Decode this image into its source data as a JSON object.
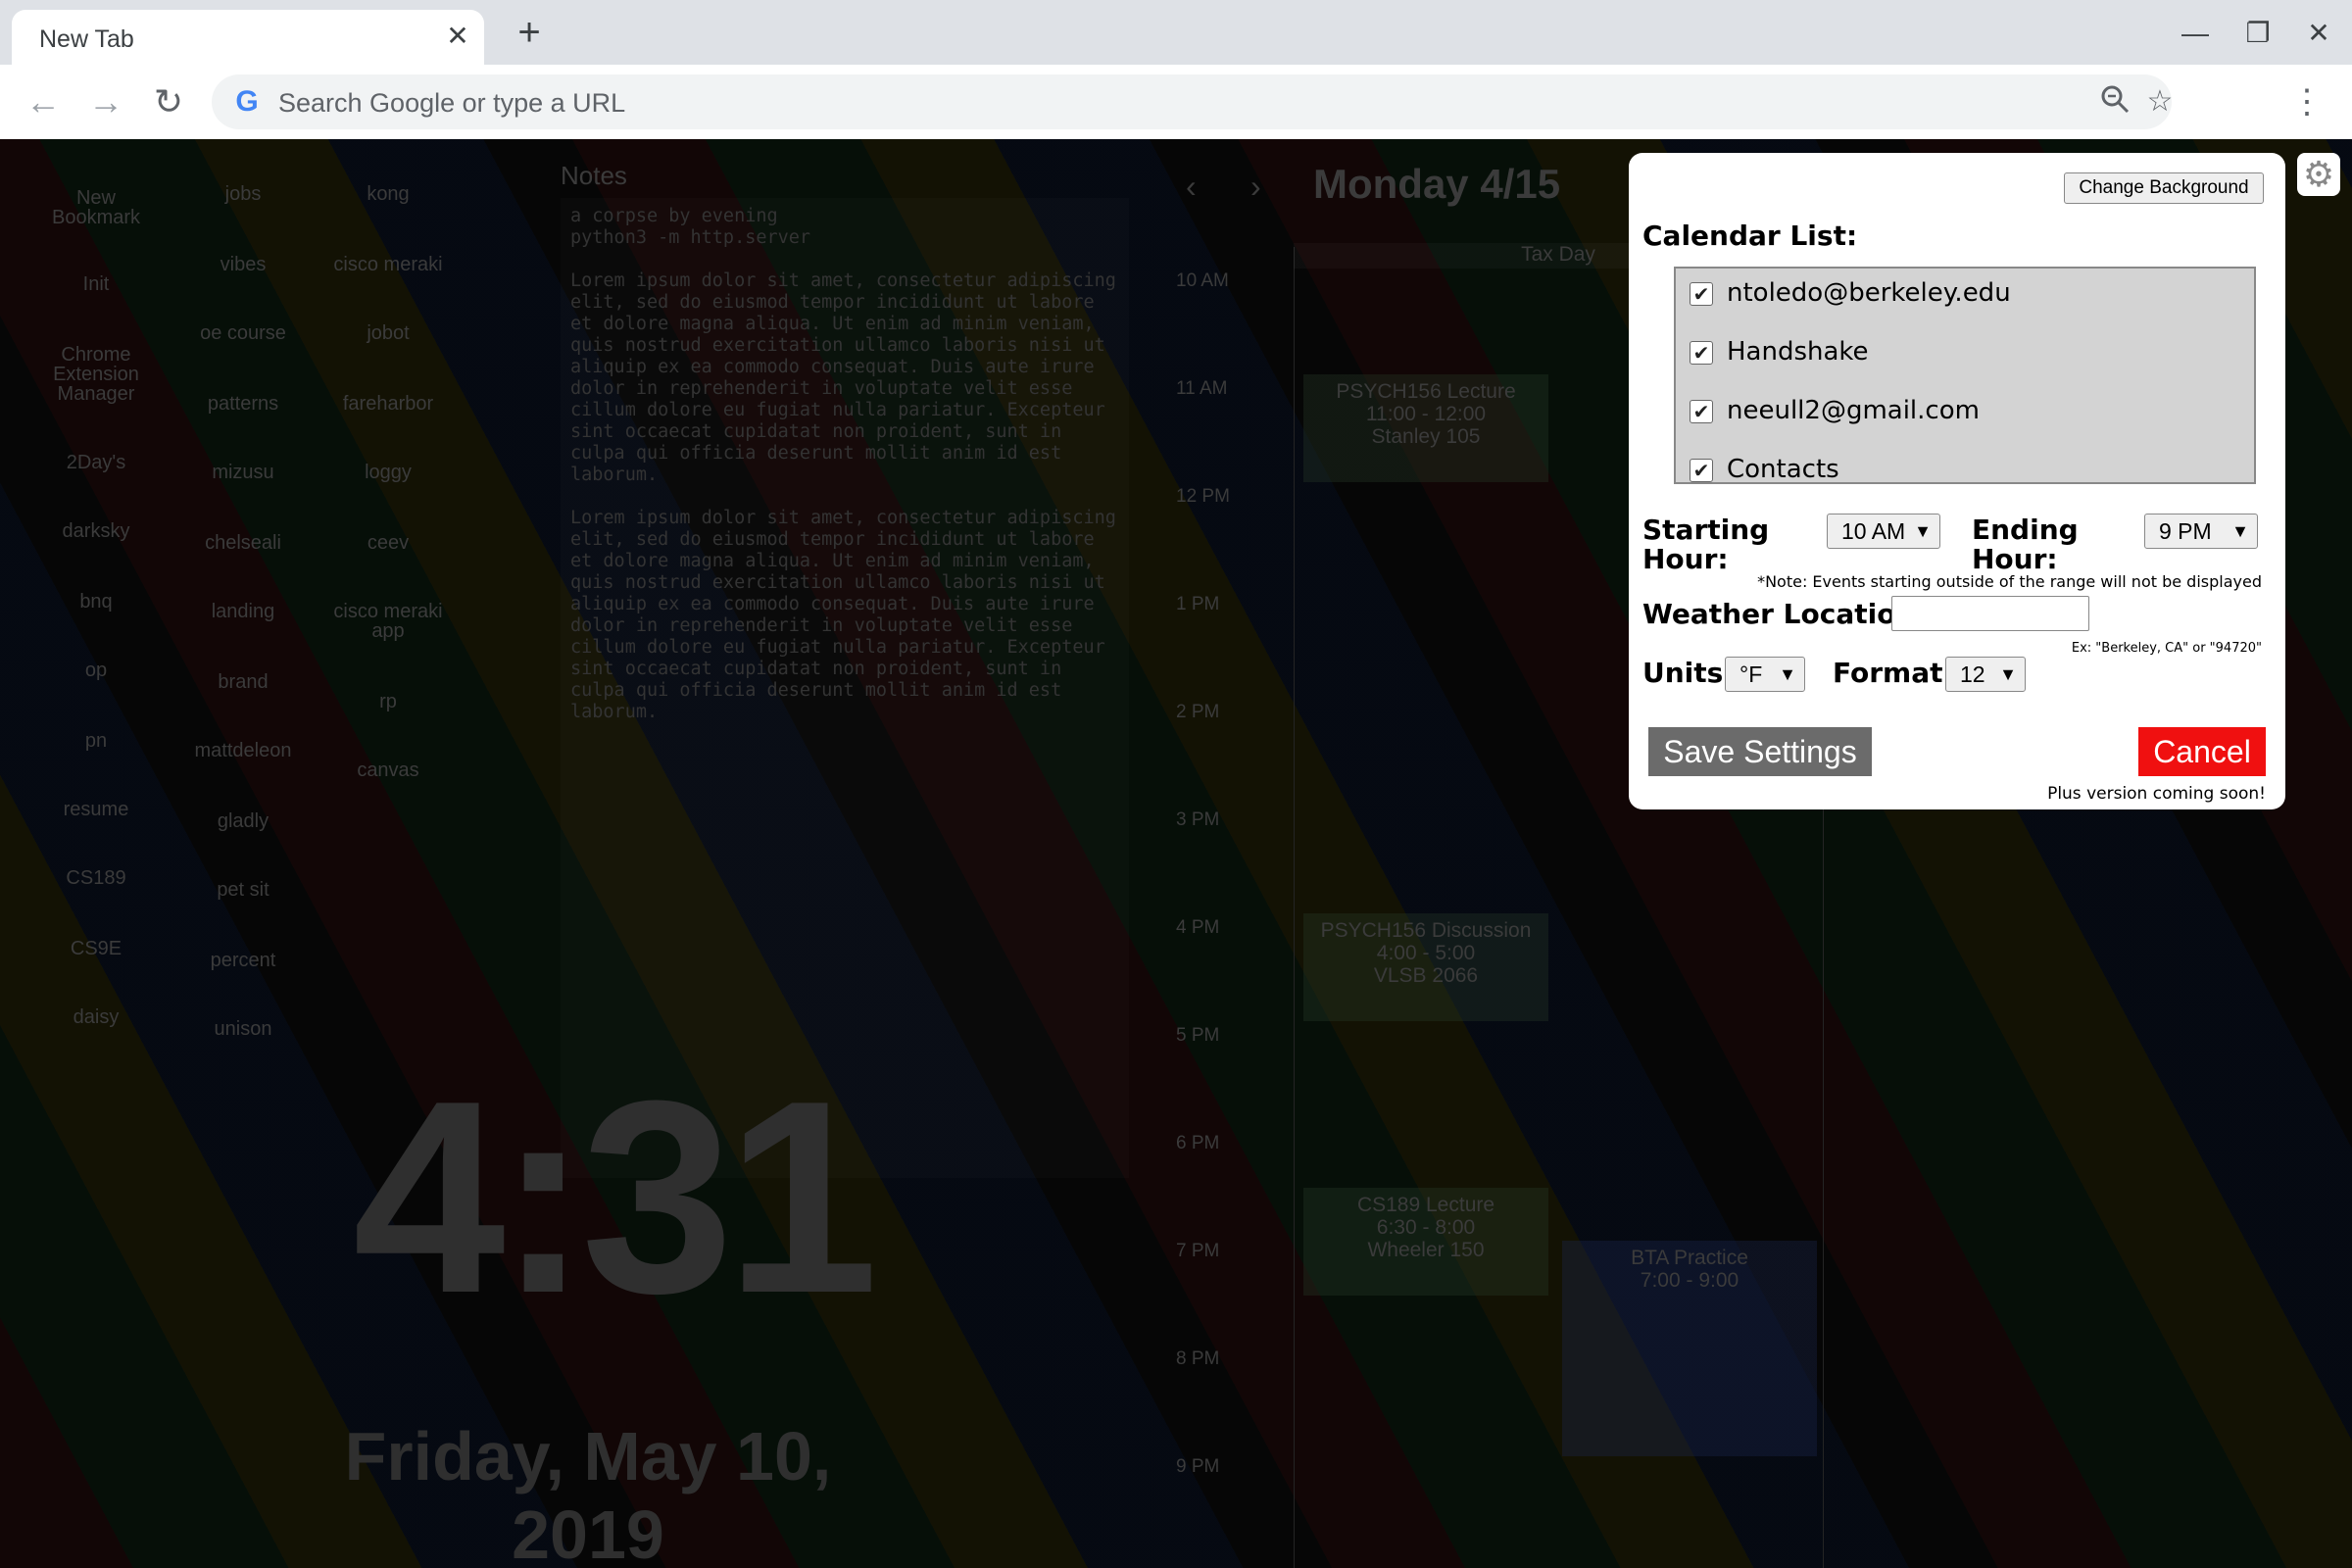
{
  "browser": {
    "tab_title": "New Tab",
    "tab_close": "✕",
    "new_tab": "+",
    "window_minimize": "—",
    "window_restore": "❐",
    "window_close": "✕",
    "omnibox_placeholder": "Search Google or type a URL",
    "google_logo": "G",
    "icons": [
      "back-arrow",
      "forward-arrow",
      "reload",
      "zoom",
      "star",
      "menu"
    ]
  },
  "bookmarks": {
    "column1": [
      "New Bookmark",
      "Init",
      "Chrome Extension Manager",
      "2Day's",
      "darksky",
      "bnq",
      "op",
      "pn",
      "resume",
      "CS189",
      "CS9E",
      "daisy"
    ],
    "column2": [
      "jobs",
      "vibes",
      "oe course",
      "patterns",
      "mizusu",
      "chelseali",
      "landing",
      "brand",
      "mattdeleon",
      "gladly",
      "pet sit",
      "percent",
      "unison"
    ],
    "column3": [
      "kong",
      "cisco meraki",
      "jobot",
      "fareharbor",
      "loggy",
      "ceev",
      "cisco meraki app",
      "rp",
      "canvas"
    ]
  },
  "notes": {
    "title": "Notes",
    "body": "a corpse by evening\npython3 -m http.server\n\nLorem ipsum dolor sit amet, consectetur adipiscing elit, sed do eiusmod tempor incididunt ut labore et dolore magna aliqua. Ut enim ad minim veniam, quis nostrud exercitation ullamco laboris nisi ut aliquip ex ea commodo consequat. Duis aute irure dolor in reprehenderit in voluptate velit esse cillum dolore eu fugiat nulla pariatur. Excepteur sint occaecat cupidatat non proident, sunt in culpa qui officia deserunt mollit anim id est laborum.\n\nLorem ipsum dolor sit amet, consectetur adipiscing elit, sed do eiusmod tempor incididunt ut labore et dolore magna aliqua. Ut enim ad minim veniam, quis nostrud exercitation ullamco laboris nisi ut aliquip ex ea commodo consequat. Duis aute irure dolor in reprehenderit in voluptate velit esse cillum dolore eu fugiat nulla pariatur. Excepteur sint occaecat cupidatat non proident, sunt in culpa qui officia deserunt mollit anim id est laborum."
  },
  "clock": {
    "time": "4:31",
    "date": "Friday, May 10, 2019"
  },
  "calendar": {
    "prev": "‹",
    "next": "›",
    "header": "Monday 4/15",
    "all_day_event": "Tax Day",
    "hours": [
      "10 AM",
      "11 AM",
      "12 PM",
      "1 PM",
      "2 PM",
      "3 PM",
      "4 PM",
      "5 PM",
      "6 PM",
      "7 PM",
      "8 PM",
      "9 PM"
    ],
    "events": [
      {
        "title": "PSYCH156 Lecture",
        "time": "11:00 - 12:00",
        "location": "Stanley 105"
      },
      {
        "title": "PSYCH156 Discussion",
        "time": "4:00 - 5:00",
        "location": "VLSB 2066"
      },
      {
        "title": "CS189 Lecture",
        "time": "6:30 - 8:00",
        "location": "Wheeler 150"
      },
      {
        "title": "BTA Practice",
        "time": "7:00 - 9:00",
        "location": ""
      }
    ]
  },
  "settings": {
    "gear_icon": "⚙",
    "change_background": "Change Background",
    "calendar_list_label": "Calendar List:",
    "calendars": [
      {
        "name": "ntoledo@berkeley.edu",
        "checked": true
      },
      {
        "name": "Handshake",
        "checked": true
      },
      {
        "name": "neeull2@gmail.com",
        "checked": true
      },
      {
        "name": "Contacts",
        "checked": true
      }
    ],
    "check_mark": "✔",
    "starting_hour_label": "Starting Hour:",
    "starting_hour_value": "10 AM",
    "ending_hour_label": "Ending Hour:",
    "ending_hour_value": "9 PM",
    "range_note": "*Note: Events starting outside of the range will not be displayed",
    "weather_label": "Weather Location:",
    "weather_value": "",
    "weather_example": "Ex: \"Berkeley, CA\" or \"94720\"",
    "units_label": "Units:",
    "units_value": "°F",
    "format_label": "Format:",
    "format_value": "12",
    "dropdown_arrow": "▼",
    "save_label": "Save Settings",
    "cancel_label": "Cancel",
    "plus_note": "Plus version coming soon!"
  }
}
